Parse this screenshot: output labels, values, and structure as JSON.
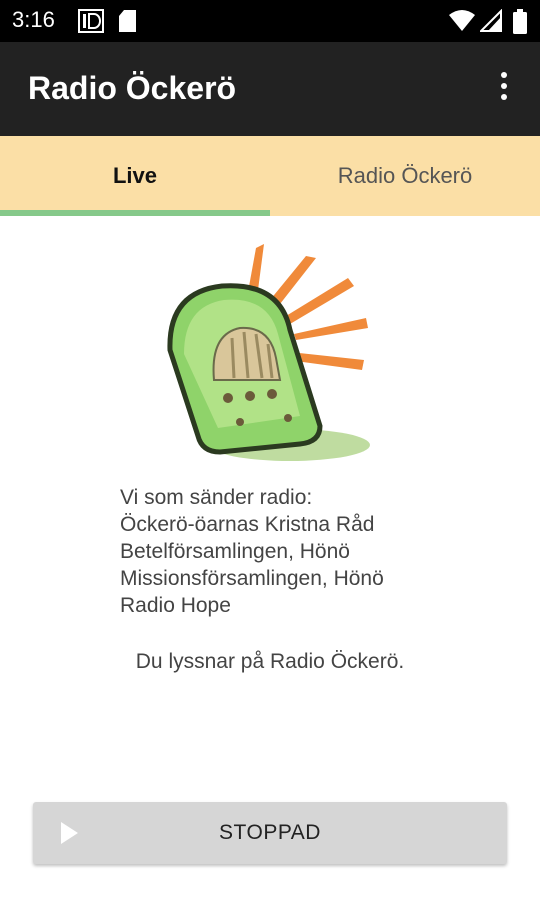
{
  "status_bar": {
    "time": "3:16",
    "icons": [
      "id-card-icon",
      "sd-card-icon",
      "wifi-icon",
      "signal-icon",
      "battery-icon"
    ]
  },
  "app_bar": {
    "title": "Radio Öckerö",
    "menu_icon": "more-vert-icon"
  },
  "tabs": [
    {
      "label": "Live",
      "selected": true
    },
    {
      "label": "Radio Öckerö",
      "selected": false
    }
  ],
  "info": {
    "lines": [
      "Vi som sänder radio:",
      "Öckerö-öarnas Kristna Råd",
      "Betelförsamlingen, Hönö",
      "Missionsförsamlingen, Hönö",
      "Radio Hope"
    ],
    "status": "Du lyssnar på Radio Öckerö."
  },
  "player": {
    "label": "STOPPAD",
    "icon": "play-icon"
  },
  "colors": {
    "status_bar": "#000000",
    "app_bar": "#222222",
    "tab_bar": "#fbdfa6",
    "tab_indicator": "#86c98a",
    "button": "#d6d6d6"
  }
}
